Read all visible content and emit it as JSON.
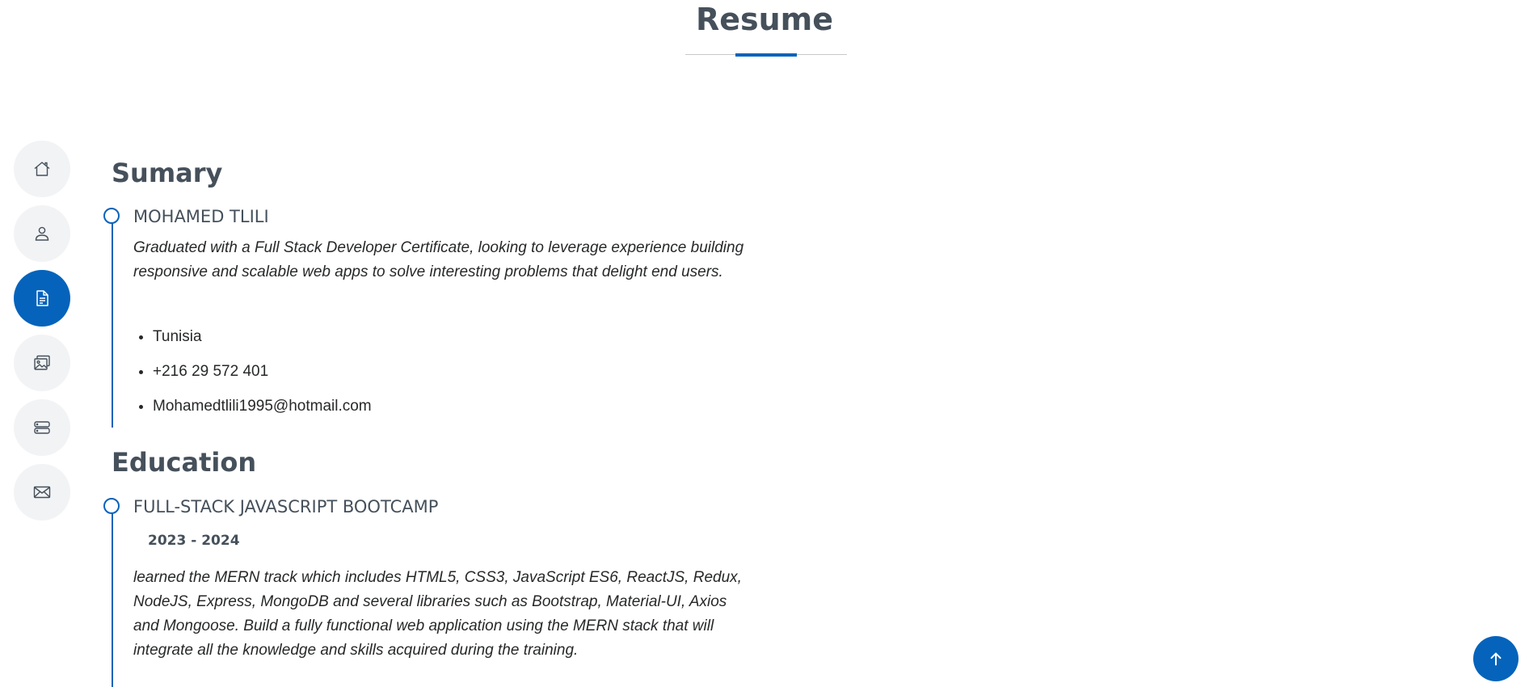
{
  "section": {
    "title": "Resume"
  },
  "nav": [
    {
      "icon": "home-icon",
      "active": false
    },
    {
      "icon": "person-icon",
      "active": false
    },
    {
      "icon": "file-text-icon",
      "active": true
    },
    {
      "icon": "images-icon",
      "active": false
    },
    {
      "icon": "server-icon",
      "active": false
    },
    {
      "icon": "envelope-icon",
      "active": false
    }
  ],
  "summary": {
    "heading": "Sumary",
    "name": "MOHAMED TLILI",
    "description": "Graduated with a Full Stack Developer Certificate, looking to leverage experience building responsive and scalable web apps to solve interesting problems that delight end users.",
    "contacts": [
      "Tunisia",
      "+216 29 572 401",
      "Mohamedtlili1995@hotmail.com"
    ]
  },
  "education": {
    "heading": "Education",
    "items": [
      {
        "title": "FULL-STACK JAVASCRIPT BOOTCAMP",
        "dates": "2023 - 2024",
        "description": "learned the MERN track which includes HTML5, CSS3, JavaScript ES6, ReactJS, Redux, NodeJS, Express, MongoDB and several libraries such as Bootstrap, Material-UI, Axios and Mongoose. Build a fully functional web application using the MERN stack that will integrate all the knowledge and skills acquired during the training."
      }
    ]
  },
  "colors": {
    "accent": "#0563bb",
    "heading": "#45505b",
    "text": "#272829",
    "nav_bg": "#f2f3f5"
  },
  "back_to_top_icon": "arrow-up-icon"
}
